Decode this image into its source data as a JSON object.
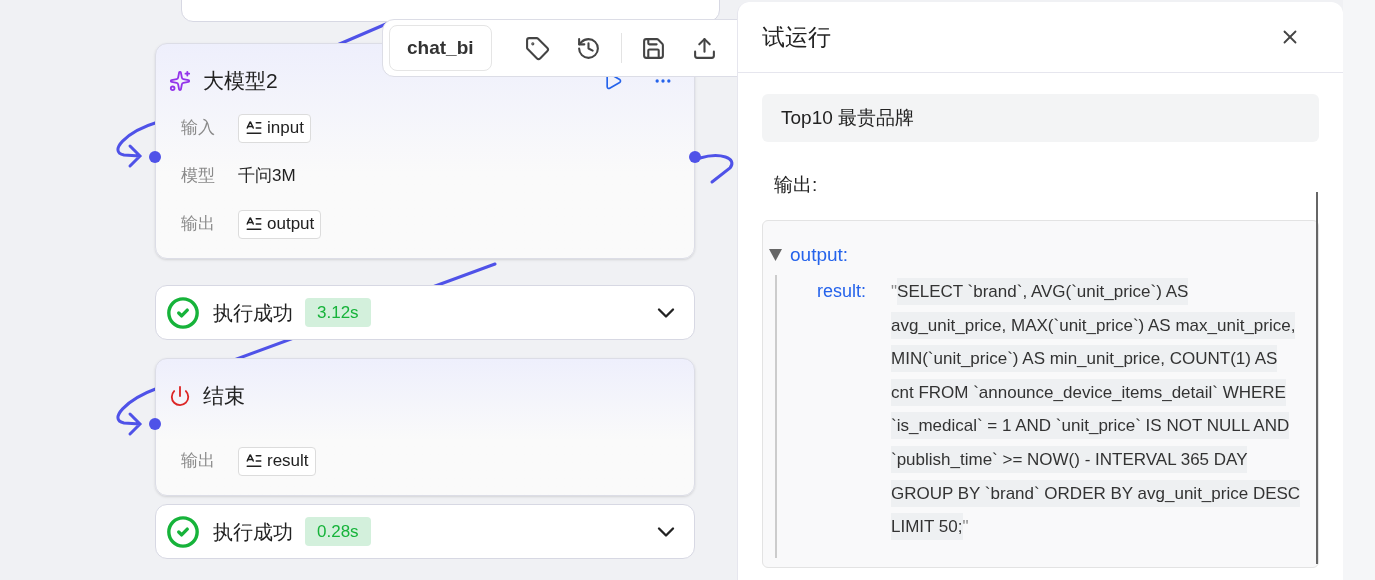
{
  "canvas": {
    "nodes": [
      {
        "kind": "llm",
        "title": "大模型2",
        "fields": [
          {
            "label": "输入",
            "value": "input",
            "kind": "variable"
          },
          {
            "label": "模型",
            "value": "千问3M",
            "kind": "text"
          },
          {
            "label": "输出",
            "value": "output",
            "kind": "variable"
          }
        ],
        "status": {
          "label": "执行成功",
          "duration": "3.12s"
        }
      },
      {
        "kind": "end",
        "title": "结束",
        "fields": [
          {
            "label": "输出",
            "value": "result",
            "kind": "variable"
          }
        ],
        "status": {
          "label": "执行成功",
          "duration": "0.28s"
        }
      }
    ]
  },
  "toolbar": {
    "name": "chat_bi"
  },
  "panel": {
    "title": "试运行",
    "input": "Top10 最贵品牌",
    "output_label": "输出:",
    "output": {
      "key": "output:",
      "expanded": true,
      "entries": [
        {
          "key": "result:",
          "open_quote": "\"",
          "value": "SELECT `brand`, AVG(`unit_price`) AS avg_unit_price, MAX(`unit_price`) AS max_unit_price, MIN(`unit_price`) AS min_unit_price, COUNT(1) AS cnt FROM `announce_device_items_detail` WHERE `is_medical` = 1 AND `unit_price` IS NOT NULL AND `publish_time` >= NOW() - INTERVAL 365 DAY GROUP BY `brand` ORDER BY avg_unit_price DESC LIMIT 50;",
          "close_quote": "\""
        }
      ]
    }
  }
}
